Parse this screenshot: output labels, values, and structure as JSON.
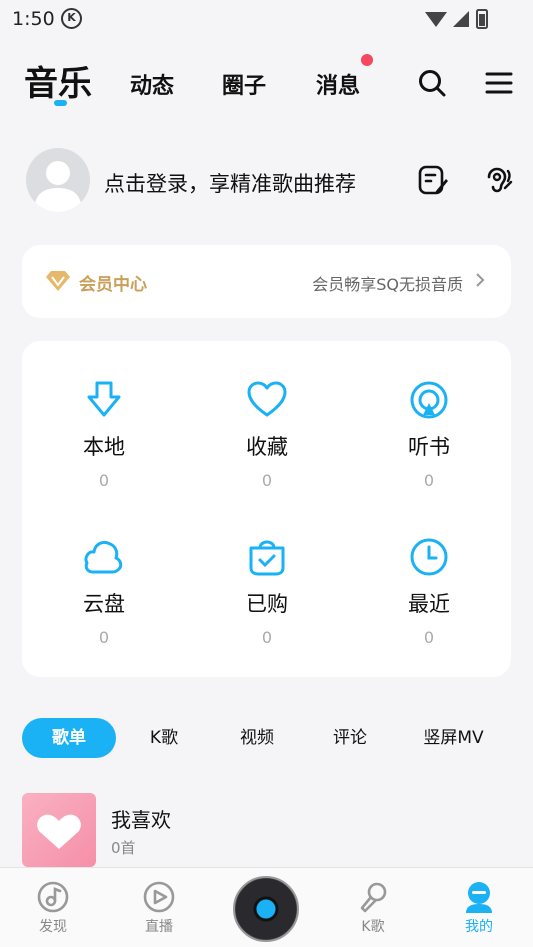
{
  "status_bar": {
    "time": "1:50",
    "badge": "K"
  },
  "nav": {
    "tabs": [
      {
        "label": "音乐",
        "active": true
      },
      {
        "label": "动态"
      },
      {
        "label": "圈子"
      },
      {
        "label": "消息",
        "has_dot": true
      }
    ]
  },
  "login": {
    "prompt": "点击登录，享精准歌曲推荐"
  },
  "vip": {
    "title": "会员中心",
    "desc": "会员畅享SQ无损音质"
  },
  "grid": [
    {
      "label": "本地",
      "count": "0",
      "icon": "download-icon"
    },
    {
      "label": "收藏",
      "count": "0",
      "icon": "heart-icon"
    },
    {
      "label": "听书",
      "count": "0",
      "icon": "audiobook-icon"
    },
    {
      "label": "云盘",
      "count": "0",
      "icon": "cloud-icon"
    },
    {
      "label": "已购",
      "count": "0",
      "icon": "purchased-icon"
    },
    {
      "label": "最近",
      "count": "0",
      "icon": "clock-icon"
    }
  ],
  "pills": [
    "歌单",
    "K歌",
    "视频",
    "评论",
    "竖屏MV"
  ],
  "playlist": {
    "title": "我喜欢",
    "count": "0首"
  },
  "bottom_nav": [
    {
      "label": "发现",
      "icon": "discover-icon"
    },
    {
      "label": "直播",
      "icon": "live-icon"
    },
    {
      "label": "",
      "icon": "player-disc-icon"
    },
    {
      "label": "K歌",
      "icon": "karaoke-icon"
    },
    {
      "label": "我的",
      "icon": "profile-icon",
      "active": true
    }
  ],
  "colors": {
    "accent": "#1ab2f5",
    "vip_gold": "#c9a05a",
    "notification": "#f5485f"
  }
}
